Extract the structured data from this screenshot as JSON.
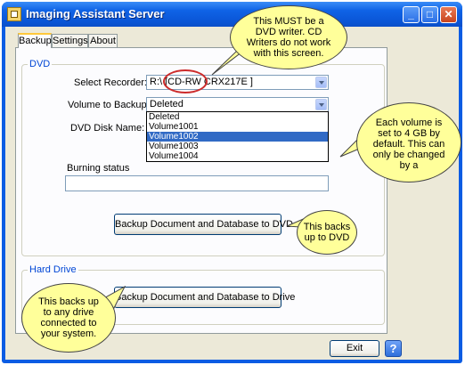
{
  "window": {
    "title": "Imaging Assistant Server"
  },
  "tabs": [
    {
      "label": "Backup"
    },
    {
      "label": "Settings"
    },
    {
      "label": "About"
    }
  ],
  "dvd_group": {
    "label": "DVD",
    "select_recorder_label": "Select Recorder:",
    "recorder_value": "R:\\ [CD-RW  CRX217E  ]",
    "volume_label": "Volume to Backup:",
    "volume_value": "Deleted",
    "volume_options": [
      "Deleted",
      "Volume1001",
      "Volume1002",
      "Volume1003",
      "Volume1004"
    ],
    "volume_selected": "Volume1002",
    "disk_name_label": "DVD Disk Name:",
    "burning_status_label": "Burning status",
    "backup_dvd_button": "Backup Document and Database to DVD"
  },
  "drive_group": {
    "label": "Hard Drive",
    "backup_drive_button": "Backup Document and Database to Drive"
  },
  "exit_button": "Exit",
  "help_button": "?",
  "callouts": {
    "dvd_writer": "This MUST be a DVD writer.  CD Writers do not work with this screen.",
    "volume_size": "Each volume is set to 4 GB by default.  This can only be changed by a",
    "backs_dvd": "This backs up to DVD",
    "backs_drive": "This backs up to any drive connected to your system."
  },
  "colors": {
    "titlebar": "#0a55d6",
    "callout": "#ffff9a",
    "highlight": "#316ac5",
    "circle": "#cc2b2b"
  }
}
